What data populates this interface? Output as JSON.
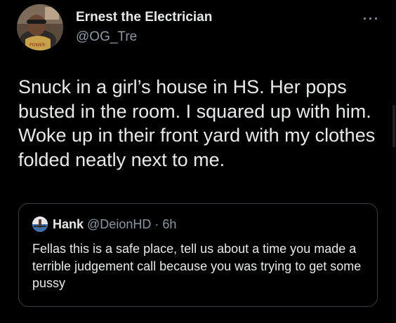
{
  "author": {
    "name": "Ernest the Electrician",
    "handle": "@OG_Tre",
    "avatar_icon": "profile-photo"
  },
  "more_icon": "more-horizontal-icon",
  "tweet_text": "Snuck in a girl’s house in HS. Her pops busted in the room. I squared up with him. Woke up in their front yard with my clothes folded neatly next to me.",
  "quoted": {
    "name": "Hank",
    "handle": "@DeionHD",
    "separator": " · ",
    "time": "6h",
    "avatar_icon": "pier-sunset-photo",
    "text": "Fellas this is a safe place, tell us about a time you made a terrible judgement call because you was trying to get some pussy"
  },
  "colors": {
    "background": "#000000",
    "primary_text": "#e7e9ea",
    "secondary_text": "#8b98a5",
    "card_border": "#3a3f44"
  }
}
